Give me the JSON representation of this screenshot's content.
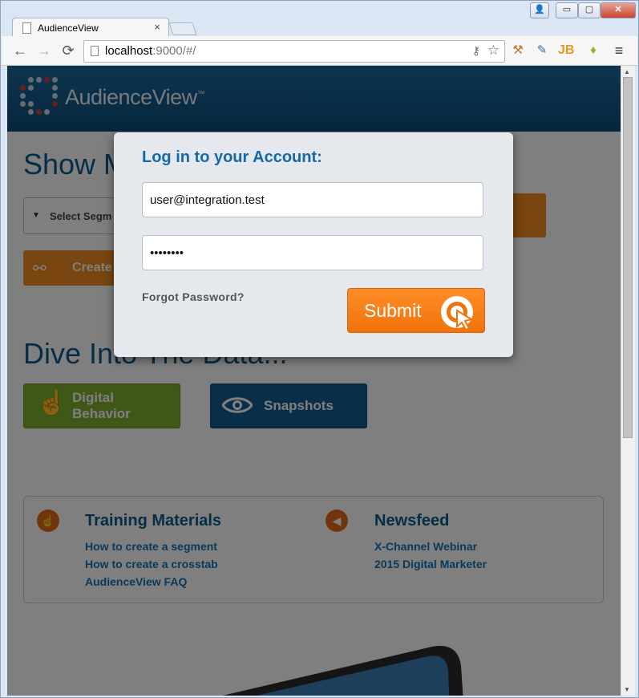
{
  "browser": {
    "tab_title": "AudienceView",
    "tab_close": "×",
    "url_host": "localhost",
    "url_rest": ":9000/#/",
    "nav": {
      "back": "←",
      "forward": "→",
      "reload": "⟳",
      "menu": "≡"
    },
    "window_controls": {
      "user": "👤",
      "minimize": "▭",
      "maximize": "▢",
      "close": "✕"
    },
    "extensions": [
      "hammer",
      "eyedropper",
      "JB",
      "android"
    ]
  },
  "page": {
    "brand": "AudienceView",
    "brand_tm": "™",
    "show_heading": "Show M",
    "select_segment_label": "Select Segm",
    "create_button_label": "Create",
    "dive_heading": "Dive Into The Data...",
    "digital_behavior_line1": "Digital",
    "digital_behavior_line2": "Behavior",
    "snapshots_label": "Snapshots",
    "training": {
      "title": "Training Materials",
      "links": [
        "How to create a segment",
        "How to create a crosstab",
        "AudienceView FAQ"
      ]
    },
    "newsfeed": {
      "title": "Newsfeed",
      "links": [
        "X-Channel Webinar",
        "2015 Digital Marketer"
      ]
    }
  },
  "login_modal": {
    "title": "Log in to your Account:",
    "email_value": "user@integration.test",
    "password_value": "password",
    "forgot_label": "Forgot Password?",
    "submit_label": "Submit"
  },
  "colors": {
    "brand_blue": "#0d5a8f",
    "accent_orange": "#f28b20",
    "digital_green": "#7fae2e",
    "snapshots_blue": "#115c93"
  }
}
